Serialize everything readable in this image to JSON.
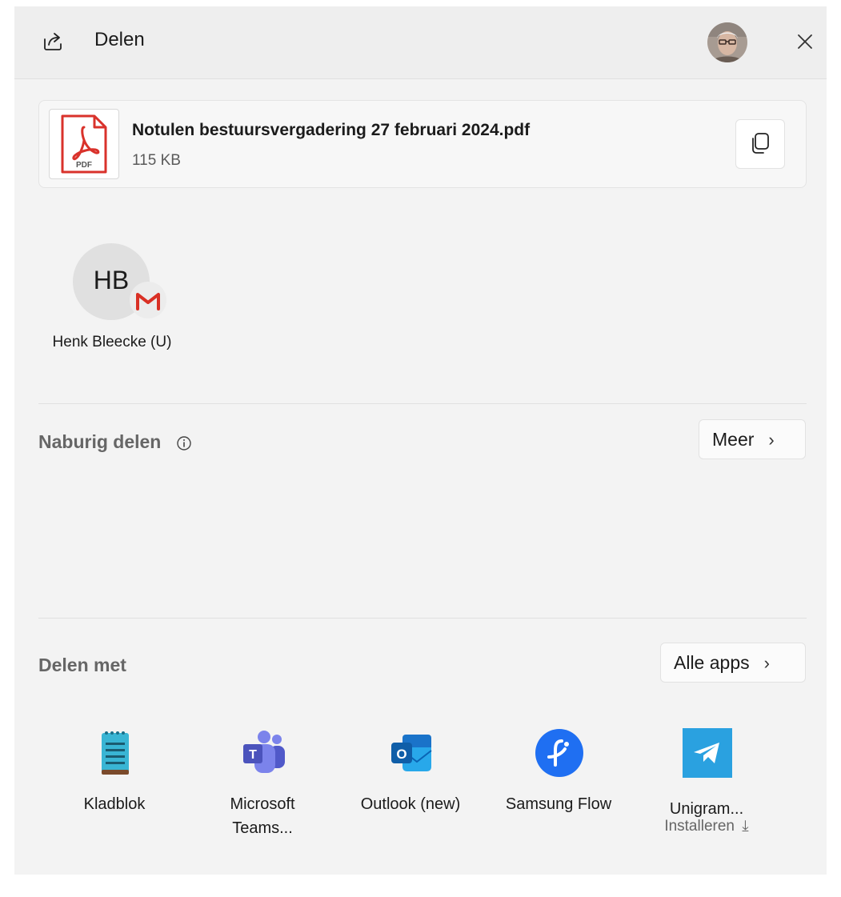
{
  "header": {
    "title": "Delen"
  },
  "file": {
    "name": "Notulen bestuursvergadering 27 februari 2024.pdf",
    "size": "115 KB",
    "thumb_label": "PDF"
  },
  "contact": {
    "initials": "HB",
    "name": "Henk Bleecke (U)"
  },
  "nearby": {
    "title": "Naburig delen",
    "more_label": "Meer"
  },
  "share_with": {
    "title": "Delen met",
    "all_apps_label": "Alle apps"
  },
  "apps": [
    {
      "label": "Kladblok",
      "icon": "notepad-icon"
    },
    {
      "label": "Microsoft Teams...",
      "icon": "teams-icon"
    },
    {
      "label": "Outlook (new)",
      "icon": "outlook-icon"
    },
    {
      "label": "Samsung Flow",
      "icon": "samsung-flow-icon"
    },
    {
      "label": "Unigram...",
      "sub": "Installeren",
      "icon": "unigram-icon"
    }
  ],
  "colors": {
    "background": "#f3f3f3",
    "pdf_red": "#d9322b",
    "gmail_red": "#d93025",
    "flow_blue": "#1f6ff2",
    "unigram_blue": "#2aa1e0"
  }
}
